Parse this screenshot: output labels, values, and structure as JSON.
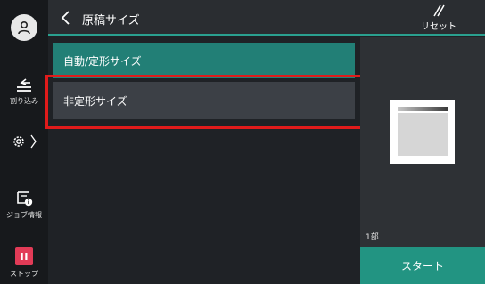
{
  "header": {
    "title": "原稿サイズ",
    "reset_label": "リセット"
  },
  "sidebar": {
    "interrupt_label": "割り込み",
    "job_info_label": "ジョブ情報",
    "stop_label": "ストップ"
  },
  "options": [
    {
      "label": "自動/定形サイズ",
      "selected": true
    },
    {
      "label": "非定形サイズ",
      "selected": false
    }
  ],
  "preview": {
    "copies_label": "1部"
  },
  "start_label": "スタート",
  "colors": {
    "accent": "#2aa08f",
    "selected": "#227f76",
    "stop": "#e23b57",
    "highlight": "#e01b1b"
  },
  "icons": [
    "user-icon",
    "interrupt-icon",
    "settings-gear-icon",
    "job-info-icon",
    "stop-icon",
    "back-chevron-icon",
    "reset-icon"
  ]
}
